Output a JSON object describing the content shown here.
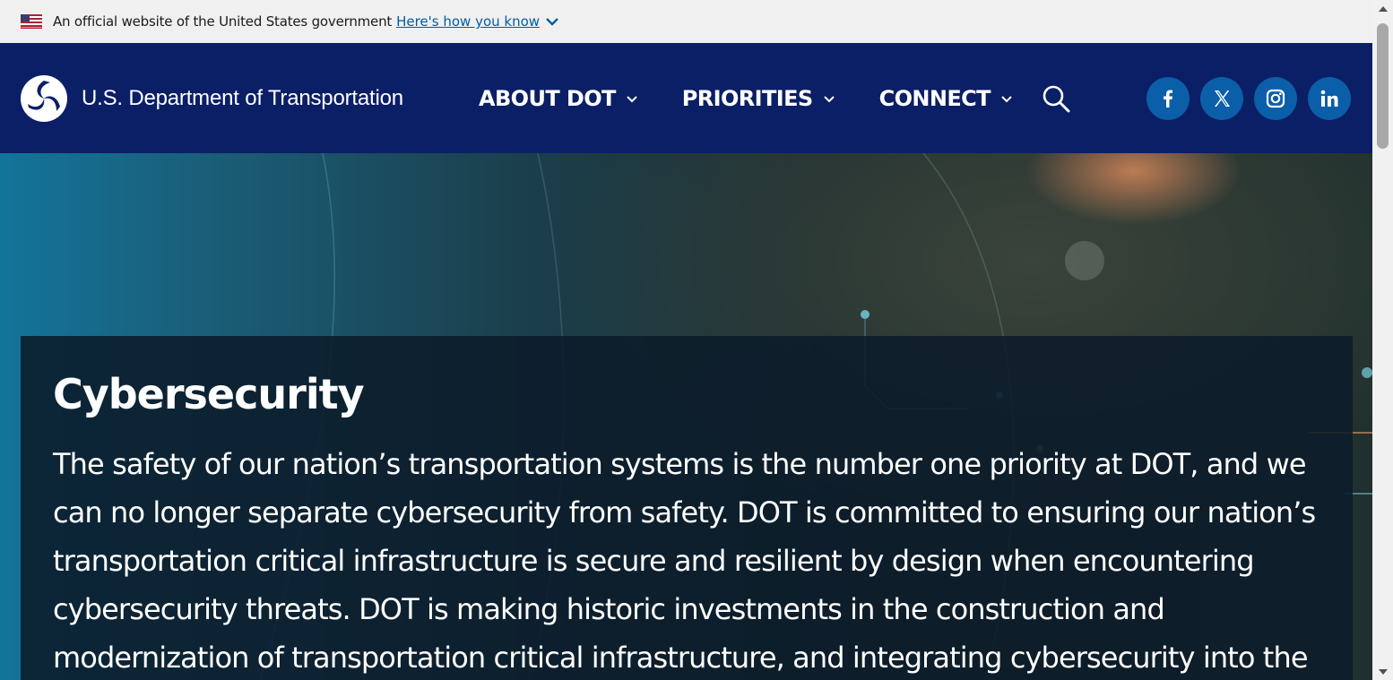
{
  "gov_banner": {
    "text": "An official website of the United States government",
    "link_label": "Here's how you know",
    "flag_icon": "us-flag-icon",
    "chevron_icon": "chevron-down-icon"
  },
  "header": {
    "logo_text": "U.S. Department of Transportation",
    "logo_icon": "dot-logo-icon",
    "nav": [
      {
        "label": "ABOUT DOT"
      },
      {
        "label": "PRIORITIES"
      },
      {
        "label": "CONNECT"
      }
    ],
    "search_icon": "search-icon",
    "social": [
      {
        "name": "facebook-icon"
      },
      {
        "name": "x-icon"
      },
      {
        "name": "instagram-icon"
      },
      {
        "name": "linkedin-icon"
      }
    ],
    "colors": {
      "background": "#0b1f66",
      "social_circle": "#0b5ea8"
    }
  },
  "hero": {
    "title": "Cybersecurity",
    "paragraph": "The safety of our nation’s transportation systems is the number one priority at DOT, and we can no longer separate cybersecurity from safety. DOT is committed to ensuring our nation’s transportation critical infrastructure is secure and resilient by design when encountering cybersecurity threats. DOT is making historic investments in the construction and modernization of transportation critical infrastructure, and integrating cybersecurity into the"
  },
  "colors": {
    "gov_banner_bg": "#f0f0f0",
    "link": "#005ea2",
    "content_box": "#0b1b2a"
  }
}
